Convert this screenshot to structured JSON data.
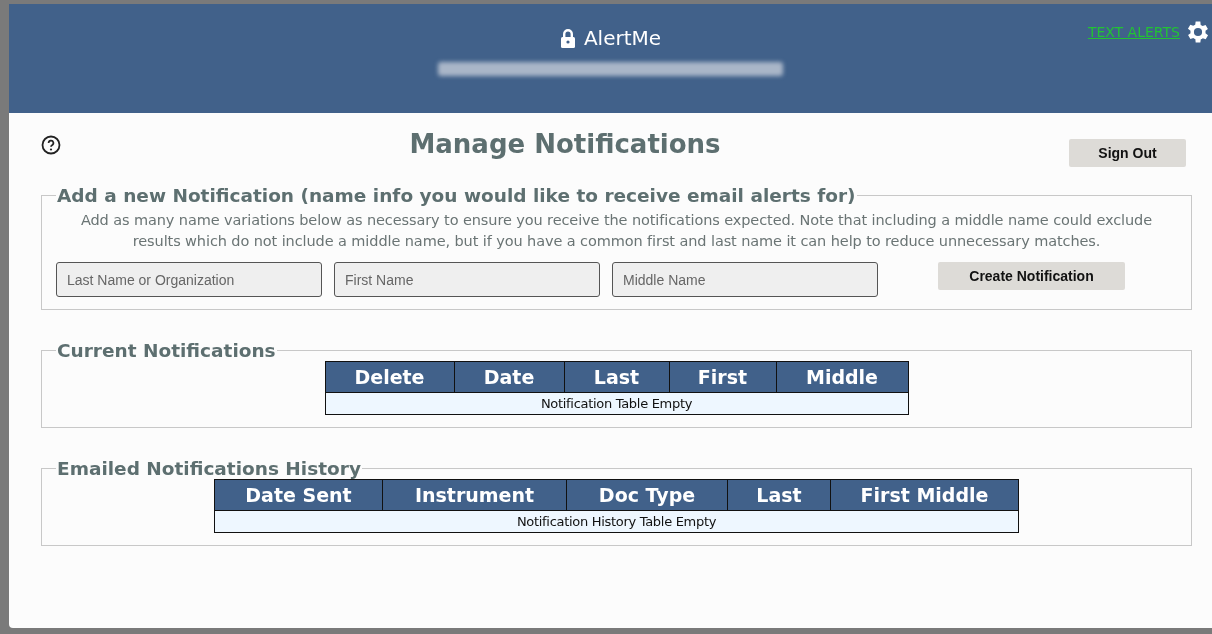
{
  "header": {
    "app_name": "AlertMe",
    "text_alerts_link": "TEXT ALERTS"
  },
  "page": {
    "title": "Manage Notifications",
    "sign_out_button": "Sign Out"
  },
  "add_section": {
    "legend": "Add a new Notification (name info you would like to receive email alerts for)",
    "description": "Add as many name variations below as necessary to ensure you receive the notifications expected. Note that including a middle name could exclude results which do not include a middle name, but if you have a common first and last name it can help to reduce unnecessary matches.",
    "fields": [
      {
        "placeholder": "Last Name or Organization"
      },
      {
        "placeholder": "First Name"
      },
      {
        "placeholder": "Middle Name"
      }
    ],
    "button": "Create Notification"
  },
  "current_notifications": {
    "legend": "Current Notifications",
    "columns": [
      "Delete",
      "Date",
      "Last",
      "First",
      "Middle"
    ],
    "empty_message": "Notification Table Empty"
  },
  "history": {
    "legend": "Emailed Notifications History",
    "columns": [
      "Date Sent",
      "Instrument",
      "Doc Type",
      "Last",
      "First Middle"
    ],
    "empty_message": "Notification History Table Empty"
  }
}
